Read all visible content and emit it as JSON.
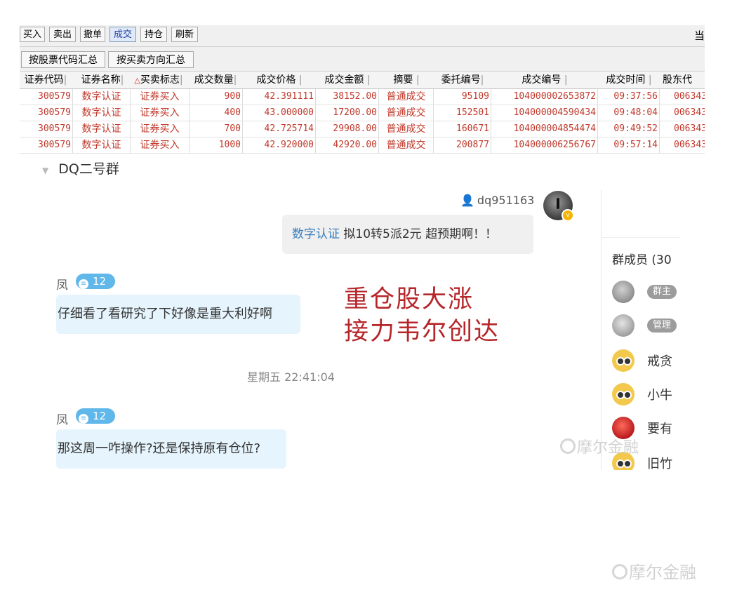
{
  "toolbar": {
    "buttons": [
      "买入",
      "卖出",
      "撤单",
      "成交",
      "持仓",
      "刷新"
    ],
    "right_text": "当"
  },
  "summary_buttons": [
    "按股票代码汇总",
    "按买卖方向汇总"
  ],
  "table": {
    "headers": [
      "证券代码",
      "证券名称",
      "买卖标志",
      "成交数量",
      "成交价格",
      "成交金额",
      "摘要",
      "委托编号",
      "成交编号",
      "成交时间",
      "股东代"
    ],
    "rows": [
      [
        "300579",
        "数字认证",
        "证券买入",
        "900",
        "42.391111",
        "38152.00",
        "普通成交",
        "95109",
        "104000002653872",
        "09:37:56",
        "006343"
      ],
      [
        "300579",
        "数字认证",
        "证券买入",
        "400",
        "43.000000",
        "17200.00",
        "普通成交",
        "152501",
        "104000004590434",
        "09:48:04",
        "006343"
      ],
      [
        "300579",
        "数字认证",
        "证券买入",
        "700",
        "42.725714",
        "29908.00",
        "普通成交",
        "160671",
        "104000004854474",
        "09:49:52",
        "006343"
      ],
      [
        "300579",
        "数字认证",
        "证券买入",
        "1000",
        "42.920000",
        "42920.00",
        "普通成交",
        "200877",
        "104000006256767",
        "09:57:14",
        "006343"
      ]
    ]
  },
  "chat": {
    "group_name": "DQ二号群",
    "outgoing": {
      "sender": "dq951163",
      "highlight": "数字认证",
      "text": " 拟10转5派2元 超预期啊！！"
    },
    "incoming": [
      {
        "name": "凤",
        "level": "12",
        "text": "仔细看了看研究了下好像是重大利好啊"
      },
      {
        "name": "凤",
        "level": "12",
        "text": "那这周一咋操作?还是保持原有仓位?"
      }
    ],
    "timestamp": "星期五 22:41:04",
    "overlay_lines": [
      "重仓股大涨",
      "接力韦尔创达"
    ]
  },
  "members": {
    "title": "群成员 (30",
    "list": [
      {
        "tag": "群主",
        "name": ""
      },
      {
        "tag": "管理",
        "name": ""
      },
      {
        "tag": "",
        "name": "戒贪"
      },
      {
        "tag": "",
        "name": "小牛"
      },
      {
        "tag": "",
        "name": "要有"
      },
      {
        "tag": "",
        "name": "旧竹"
      }
    ]
  },
  "watermark": "摩尔金融",
  "colors": {
    "trade_text": "#c0392b",
    "accent_blue": "#3a7dbd",
    "overlay_red": "#b5262a",
    "level_badge": "#5fb7ea"
  }
}
